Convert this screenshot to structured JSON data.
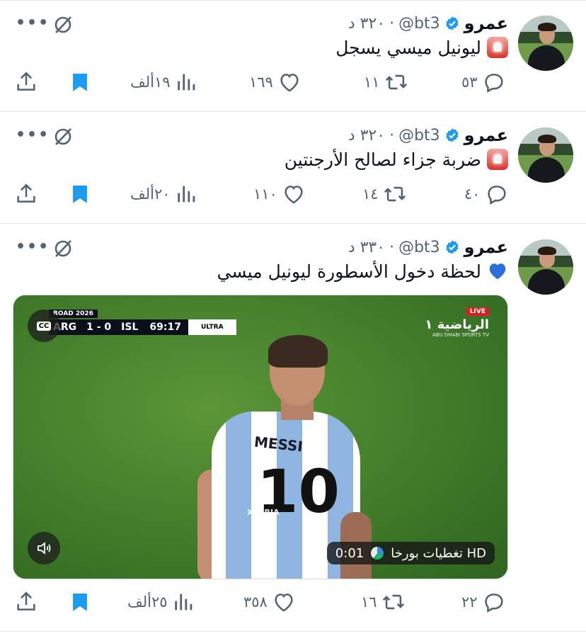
{
  "colors": {
    "text": "#0f1419",
    "secondary": "#536471",
    "bookmark_blue": "#1d9bf0",
    "verified_blue": "#1d9bf0",
    "divider": "#e5e8eb"
  },
  "tweets": [
    {
      "name": "عمرو",
      "handle": "@bt3",
      "time": "٣٢٠ د",
      "text": "ليونيل ميسي يسجل",
      "emoji": "rotating-light-icon",
      "replies": "٥٣",
      "retweets": "١١",
      "likes": "١٦٩",
      "views": "١٩ألف"
    },
    {
      "name": "عمرو",
      "handle": "@bt3",
      "time": "٣٢٠ د",
      "text": "ضربة جزاء لصالح الأرجنتين",
      "emoji": "rotating-light-icon",
      "replies": "٤٠",
      "retweets": "١٤",
      "likes": "١١٠",
      "views": "٢٠ألف"
    },
    {
      "name": "عمرو",
      "handle": "@bt3",
      "time": "٣٣٠ د",
      "text": "لحظة دخول الأسطورة ليونيل ميسي",
      "emoji": "blue-heart-icon",
      "replies": "٢٢",
      "retweets": "١٦",
      "likes": "٣٥٨",
      "views": "٢٥ألف",
      "video": {
        "score_home": "ARG",
        "score": "1 - 0",
        "score_away": "ISL",
        "clock": "69:17",
        "ultra": "ULTRA",
        "road": "ROAD 2026",
        "cc": "CC",
        "live": "LIVE",
        "channel": "الرياضية ١",
        "channel_sub": "ABU DHABI SPORTS TV",
        "player_name": "MESSI",
        "player_number": "10",
        "watermark": "XB8RJA",
        "duration": "0:01",
        "source": "تغطيات بورخا HD"
      }
    }
  ]
}
